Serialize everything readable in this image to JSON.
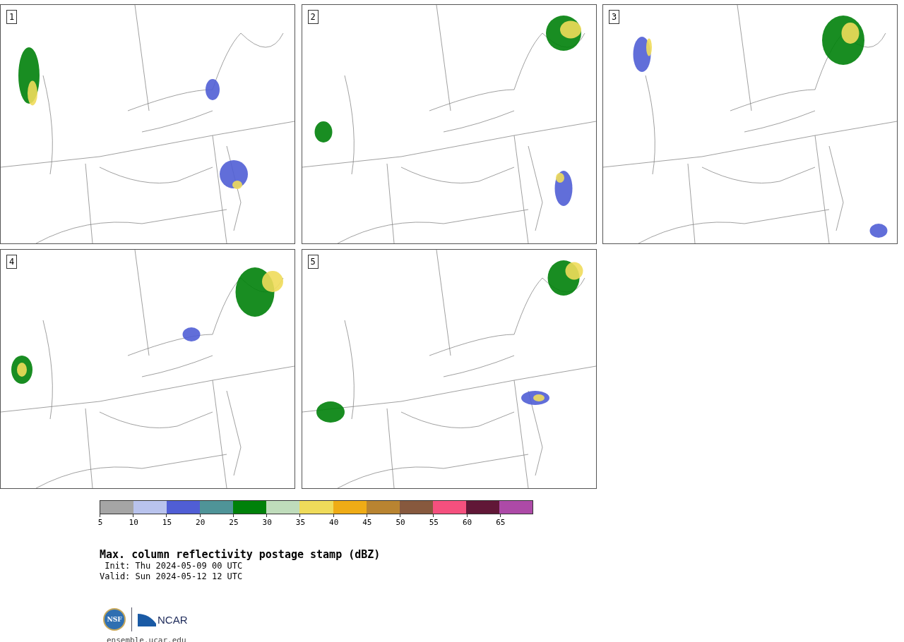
{
  "panels": [
    {
      "number": "1"
    },
    {
      "number": "2"
    },
    {
      "number": "3"
    },
    {
      "number": "4"
    },
    {
      "number": "5"
    }
  ],
  "colorbar": [
    {
      "label": "5",
      "color": "#a5a5a5"
    },
    {
      "label": "10",
      "color": "#b9c3ed"
    },
    {
      "label": "15",
      "color": "#505ed5"
    },
    {
      "label": "20",
      "color": "#4f9498"
    },
    {
      "label": "25",
      "color": "#00810a"
    },
    {
      "label": "30",
      "color": "#bfdcbb"
    },
    {
      "label": "35",
      "color": "#efdb5a"
    },
    {
      "label": "40",
      "color": "#efac16"
    },
    {
      "label": "45",
      "color": "#b98431"
    },
    {
      "label": "50",
      "color": "#87593e"
    },
    {
      "label": "55",
      "color": "#f5507e"
    },
    {
      "label": "60",
      "color": "#611737"
    },
    {
      "label": "65",
      "color": "#ad4aa7"
    }
  ],
  "title": "Max. column reflectivity postage stamp (dBZ)",
  "init": " Init: Thu 2024-05-09 00 UTC",
  "valid": "Valid: Sun 2024-05-12 12 UTC",
  "logos": {
    "nsf": "NSF",
    "ncar": "NCAR"
  },
  "url": "ensemble.ucar.edu"
}
